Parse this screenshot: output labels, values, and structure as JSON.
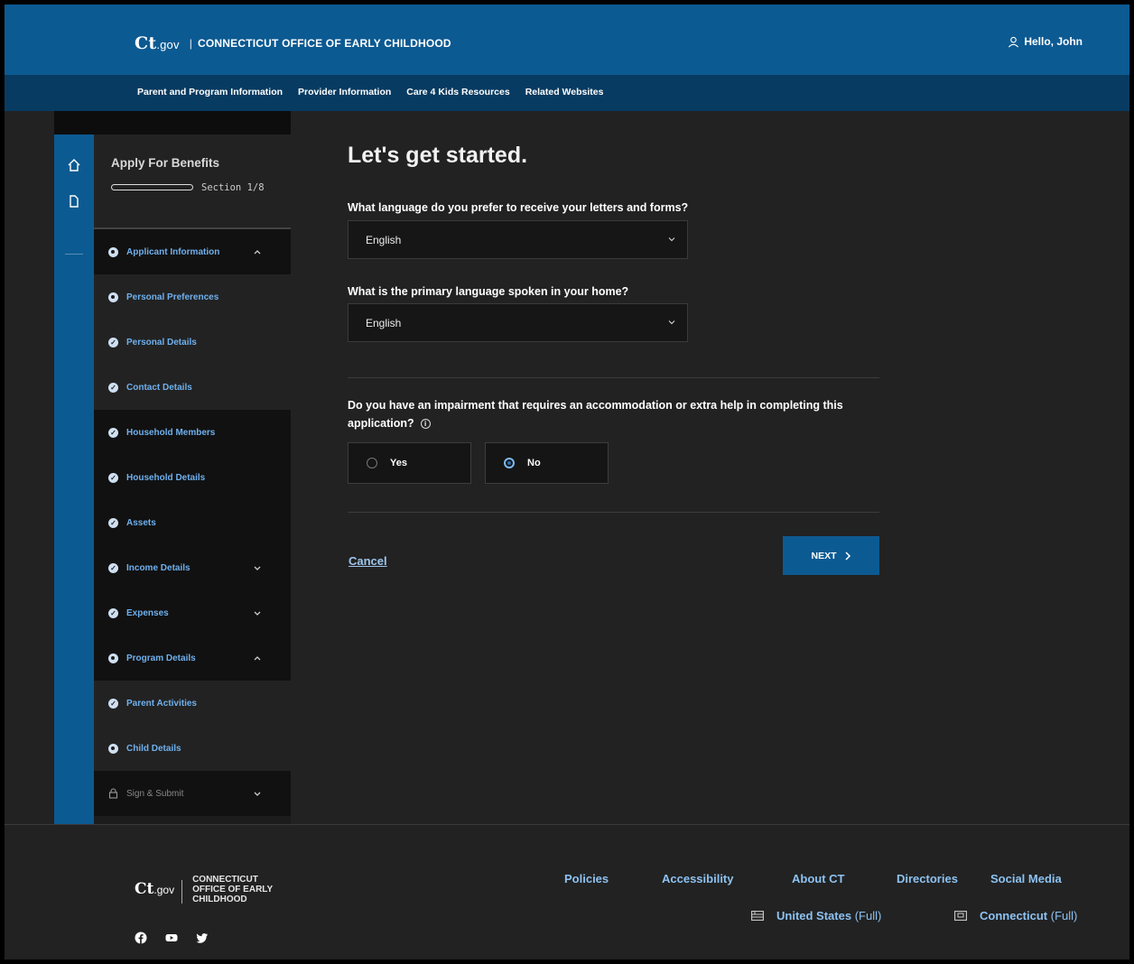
{
  "header": {
    "logo_main": "Ct",
    "logo_sub": ".gov",
    "agency": "CONNECTICUT OFFICE OF EARLY CHILDHOOD",
    "greeting": "Hello, John"
  },
  "nav": {
    "items": [
      {
        "label": "Parent and Program Information"
      },
      {
        "label": "Provider Information"
      },
      {
        "label": "Care 4 Kids Resources"
      },
      {
        "label": "Related Websites"
      }
    ]
  },
  "sidebar": {
    "title": "Apply For Benefits",
    "section": "Section 1/8",
    "items": [
      {
        "label": "Applicant Information"
      },
      {
        "label": "Personal Preferences"
      },
      {
        "label": "Personal Details"
      },
      {
        "label": "Contact Details"
      },
      {
        "label": "Household Members"
      },
      {
        "label": "Household Details"
      },
      {
        "label": "Assets"
      },
      {
        "label": "Income Details"
      },
      {
        "label": "Expenses"
      },
      {
        "label": "Program Details"
      },
      {
        "label": "Parent Activities"
      },
      {
        "label": "Child Details"
      },
      {
        "label": "Sign & Submit"
      }
    ]
  },
  "main": {
    "title": "Let's get started.",
    "q1": "What language do you prefer to receive your letters and forms?",
    "q1_value": "English",
    "q2": "What is the primary language spoken in your home?",
    "q2_value": "English",
    "q3": "Do you have an impairment that requires an accommodation or extra help in completing this application?",
    "yes_label": "Yes",
    "no_label": "No",
    "cancel_label": "Cancel",
    "next_label": "NEXT"
  },
  "footer": {
    "logo_main": "Ct",
    "logo_sub": ".gov",
    "agency_line1": "CONNECTICUT",
    "agency_line2": "OFFICE OF EARLY",
    "agency_line3": "CHILDHOOD",
    "links": [
      {
        "label": "Policies"
      },
      {
        "label": "Accessibility"
      },
      {
        "label": "About CT"
      },
      {
        "label": "Directories"
      },
      {
        "label": "Social Media"
      }
    ],
    "us_label": "United States",
    "us_suffix": "(Full)",
    "ct_label": "Connecticut",
    "ct_suffix": "(Full)"
  },
  "colors": {
    "brand_blue": "#0c5a92",
    "nav_blue": "#083b61",
    "link_blue": "#8dc2f2"
  }
}
